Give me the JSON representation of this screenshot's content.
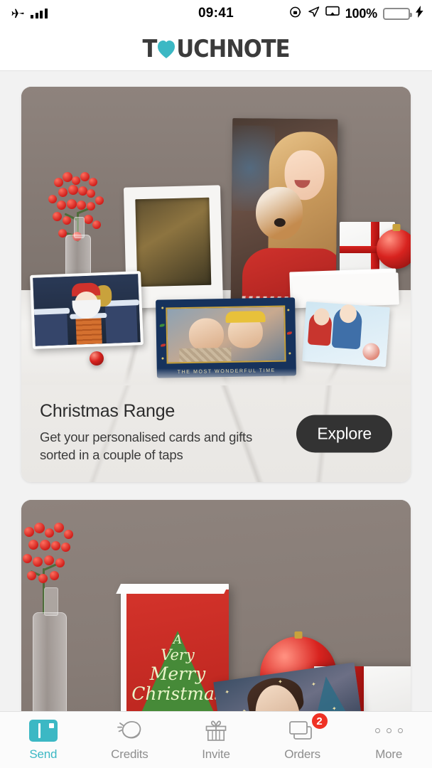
{
  "status_bar": {
    "airplane_icon": "airplane-mode-icon",
    "signal_icon": "cellular-signal-icon",
    "time": "09:41",
    "rotation_lock_icon": "rotation-lock-icon",
    "location_icon": "location-arrow-icon",
    "airplay_icon": "screen-mirroring-icon",
    "battery_percent": "100%",
    "battery_icon": "battery-full-icon",
    "charging_icon": "lightning-bolt-icon",
    "battery_color": "#4cd864"
  },
  "header": {
    "logo_pre": "T",
    "logo_heart": "heart-icon",
    "logo_post": "UCHNOTE",
    "brand_color": "#3cb8c4",
    "logo_text_color": "#3b3b3b"
  },
  "cards": [
    {
      "image_alt": "Christmas photo gifts on marble surface: canvas print of girl with dog, white photo frame, Santa card, navy photo card, baubles and wrapped gifts",
      "photo_card_caption": "THE MOST WONDERFUL TIME",
      "title": "Christmas Range",
      "subtitle": "Get your personalised cards and gifts sorted in a couple of taps",
      "button_label": "Explore",
      "button_color": "#333333"
    },
    {
      "image_alt": "Red greeting card reading A Very Merry Christmas beside a red bauble, photo card and wrapped gift",
      "card_line1": "A",
      "card_line2": "Very",
      "card_line3": "Merry",
      "card_line4": "Christmas"
    }
  ],
  "tabbar": {
    "items": [
      {
        "label": "Send",
        "icon": "postcard-icon",
        "active": true,
        "badge": null
      },
      {
        "label": "Credits",
        "icon": "coin-icon",
        "active": false,
        "badge": null
      },
      {
        "label": "Invite",
        "icon": "gift-icon",
        "active": false,
        "badge": null
      },
      {
        "label": "Orders",
        "icon": "cards-stack-icon",
        "active": false,
        "badge": "2"
      },
      {
        "label": "More",
        "icon": "ellipsis-icon",
        "active": false,
        "badge": null
      }
    ],
    "active_color": "#3cb8c4",
    "inactive_color": "#8e8e8e",
    "badge_color": "#ef3124"
  }
}
